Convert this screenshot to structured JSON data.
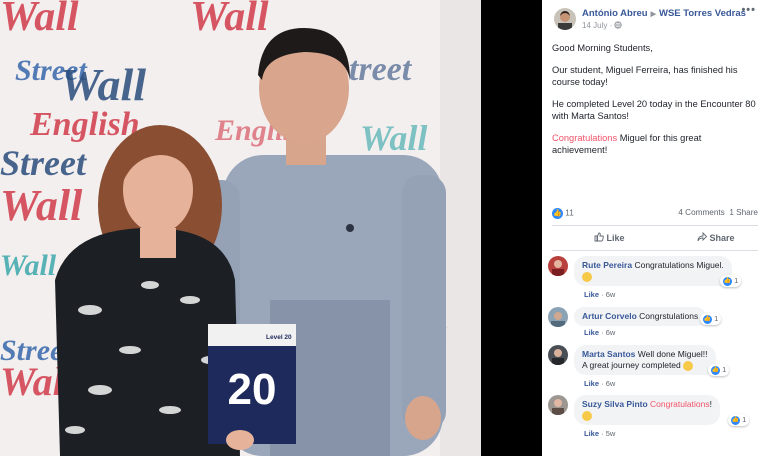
{
  "photo": {
    "card_level": "Level 20",
    "card_number": "20",
    "wall_words": [
      "Wall",
      "Street",
      "English"
    ]
  },
  "post": {
    "author": "António Abreu",
    "page": "WSE Torres Vedras",
    "date": "14 July",
    "greeting": "Good Morning Students,",
    "p1": "Our student, Miguel Ferreira, has finished his course today!",
    "p2": "He completed Level 20 today in the Encounter 80 with Marta Santos!",
    "p3_highlight": "Congratulations",
    "p3_rest": " Miguel for this great achievement!",
    "likes": "11",
    "comments_count": "4 Comments",
    "shares_count": "1 Share",
    "like_label": "Like",
    "share_label": "Share"
  },
  "comments": [
    {
      "name": "Rute Pereira",
      "text": "Congratulations Miguel.",
      "reactions": "1",
      "like": "Like",
      "age": "6w"
    },
    {
      "name": "Artur Corvelo",
      "text": "Congrstulations",
      "reactions": "1",
      "like": "Like",
      "age": "6w"
    },
    {
      "name": "Marta Santos",
      "text": "Well done Miguel!!",
      "text2": "A great journey completed",
      "reactions": "1",
      "like": "Like",
      "age": "6w"
    },
    {
      "name": "Suzy Silva Pinto",
      "highlight": "Congratulations",
      "text": "!",
      "reactions": "1",
      "like": "Like",
      "age": "5w"
    }
  ],
  "colors": {
    "link": "#385898",
    "highlight": "#f35369",
    "like": "#2d88ff"
  }
}
